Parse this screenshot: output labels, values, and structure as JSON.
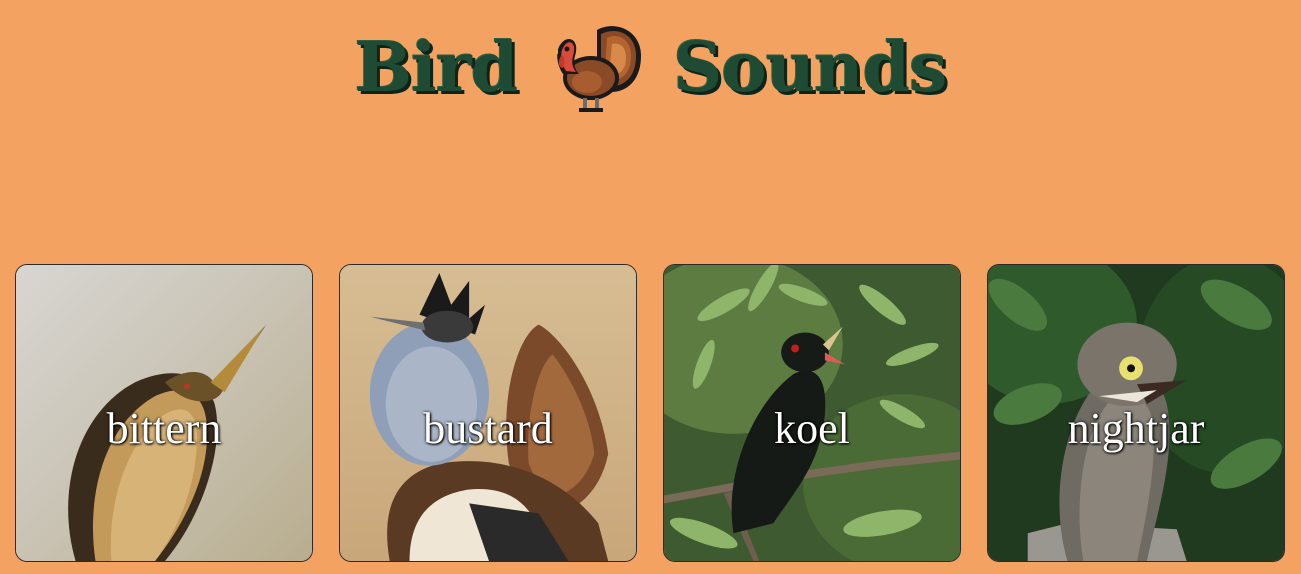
{
  "header": {
    "title_left": "Bird",
    "title_right": "Sounds",
    "icon": "turkey-icon"
  },
  "birds": [
    {
      "label": "bittern",
      "icon": "bittern-photo"
    },
    {
      "label": "bustard",
      "icon": "bustard-photo"
    },
    {
      "label": "koel",
      "icon": "koel-photo"
    },
    {
      "label": "nightjar",
      "icon": "nightjar-photo"
    }
  ],
  "colors": {
    "background": "#f3a261",
    "title": "#1f4a33",
    "label": "#ffffff"
  }
}
